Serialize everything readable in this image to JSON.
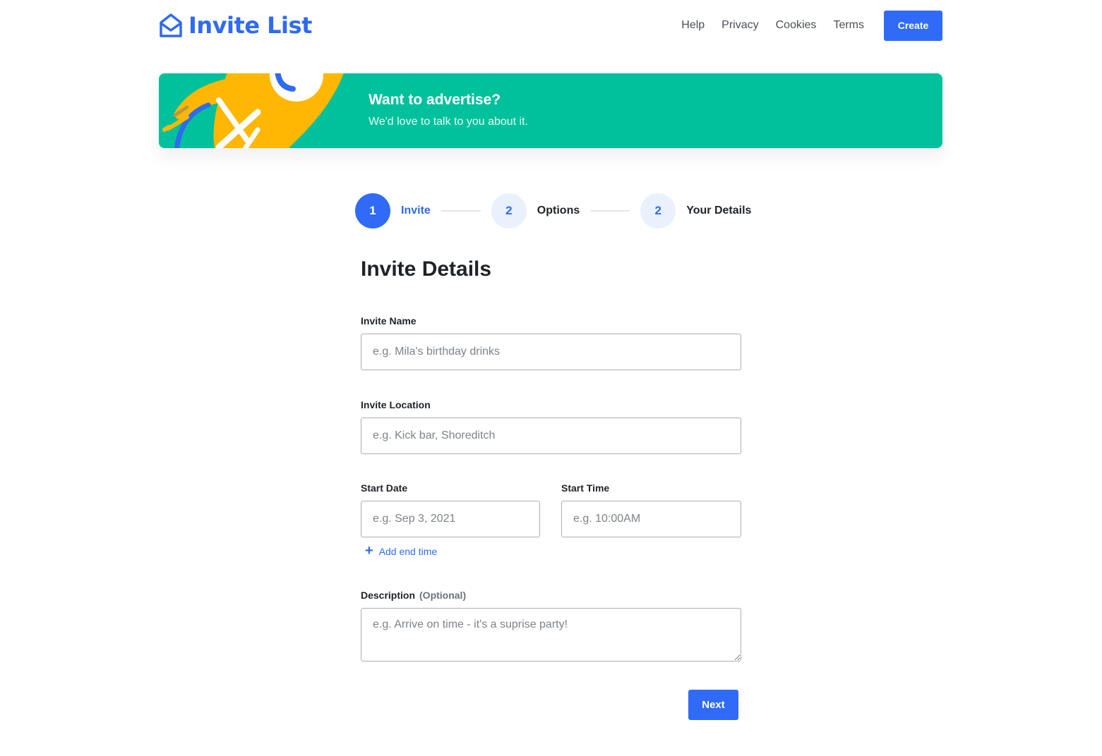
{
  "header": {
    "logo_text": "Invite List",
    "nav": [
      "Help",
      "Privacy",
      "Cookies",
      "Terms"
    ],
    "create_label": "Create"
  },
  "banner": {
    "title": "Want to advertise?",
    "subtitle": "We'd love to talk to you about it."
  },
  "stepper": {
    "steps": [
      {
        "number": "1",
        "label": "Invite",
        "active": true
      },
      {
        "number": "2",
        "label": "Options",
        "active": false
      },
      {
        "number": "2",
        "label": "Your Details",
        "active": false
      }
    ]
  },
  "form": {
    "title": "Invite Details",
    "invite_name": {
      "label": "Invite Name",
      "placeholder": "e.g. Mila's birthday drinks",
      "value": ""
    },
    "invite_location": {
      "label": "Invite Location",
      "placeholder": "e.g. Kick bar, Shoreditch",
      "value": ""
    },
    "start_date": {
      "label": "Start Date",
      "placeholder": "e.g. Sep 3, 2021",
      "value": ""
    },
    "start_time": {
      "label": "Start Time",
      "placeholder": "e.g. 10:00AM",
      "value": ""
    },
    "add_end_time_label": "Add end time",
    "description": {
      "label": "Description",
      "optional": "(Optional)",
      "placeholder": "e.g. Arrive on time - it's a suprise party!",
      "value": ""
    },
    "next_label": "Next"
  },
  "colors": {
    "brand_blue": "#2f6bf7",
    "banner_green": "#00c19c",
    "banner_yellow": "#ffb703"
  },
  "icons": {
    "logo": "envelope-open-icon",
    "add": "plus-icon"
  }
}
